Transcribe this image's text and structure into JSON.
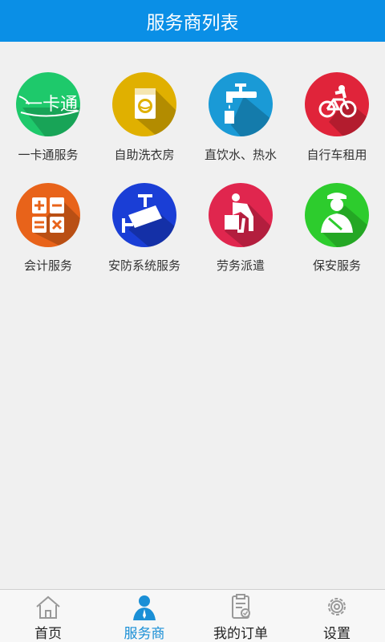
{
  "header": {
    "title": "服务商列表"
  },
  "services": [
    {
      "label": "一卡通服务",
      "icon": "card-pass-icon",
      "color": "#1ec96b"
    },
    {
      "label": "自助洗衣房",
      "icon": "washing-machine-icon",
      "color": "#e0b000"
    },
    {
      "label": "直饮水、热水",
      "icon": "water-faucet-icon",
      "color": "#1a9ad6"
    },
    {
      "label": "自行车租用",
      "icon": "bicycle-icon",
      "color": "#e0243a"
    },
    {
      "label": "会计服务",
      "icon": "calculator-icon",
      "color": "#e8631a"
    },
    {
      "label": "安防系统服务",
      "icon": "security-camera-icon",
      "color": "#1a3ed6"
    },
    {
      "label": "劳务派遣",
      "icon": "laborer-icon",
      "color": "#e0264e"
    },
    {
      "label": "保安服务",
      "icon": "security-guard-icon",
      "color": "#2dcc2d"
    }
  ],
  "card_icon_text": "一卡通",
  "tabs": [
    {
      "label": "首页",
      "icon": "home-icon",
      "active": false
    },
    {
      "label": "服务商",
      "icon": "provider-icon",
      "active": true
    },
    {
      "label": "我的订单",
      "icon": "orders-icon",
      "active": false
    },
    {
      "label": "设置",
      "icon": "settings-icon",
      "active": false
    }
  ],
  "colors": {
    "header": "#0a8fe6",
    "tab_active": "#1a8fd6",
    "background": "#f0f0f0"
  }
}
